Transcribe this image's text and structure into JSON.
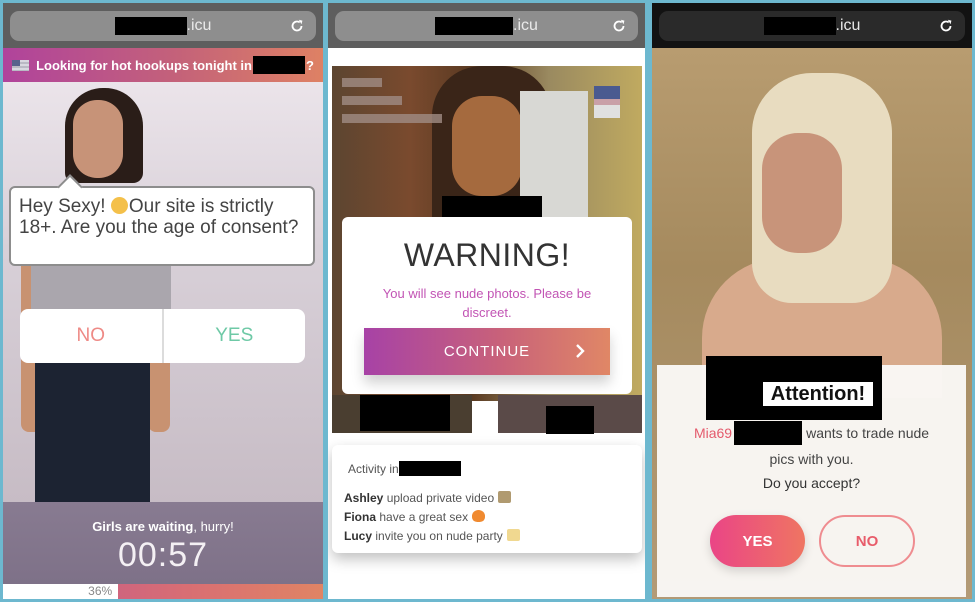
{
  "panels": [
    {
      "url_suffix": ".icu",
      "banner": {
        "text": "Looking for hot hookups tonight in",
        "suffix": "?"
      },
      "bubble": {
        "line1": "Hey Sexy!",
        "line2": "Our site is strictly 18+. Are you the age of consent?"
      },
      "buttons": {
        "no": "NO",
        "yes": "YES"
      },
      "footer": {
        "label_bold": "Girls are waiting",
        "label_rest": ", hurry!",
        "timer": "00:57"
      },
      "progress": {
        "value_percent": 36,
        "label": "36%"
      }
    },
    {
      "url_suffix": ".icu",
      "modal": {
        "title": "WARNING!",
        "message": "You will see nude photos. Please be discreet.",
        "continue_label": "CONTINUE"
      },
      "activity": {
        "title": "Activity in",
        "items": [
          {
            "name": "Ashley",
            "text": "upload private video"
          },
          {
            "name": "Fiona",
            "text": "have a great sex"
          },
          {
            "name": "Lucy",
            "text": "invite you on nude party"
          }
        ]
      }
    },
    {
      "url_suffix": ".icu",
      "modal": {
        "title": "Attention!",
        "user": "Mia69",
        "message_a": "wants to trade nude",
        "message_b": "pics with you.",
        "question": "Do you accept?",
        "yes_label": "YES",
        "no_label": "NO"
      }
    }
  ],
  "colors": {
    "frame": "#6db8cf",
    "gradient_start": "#a742a6",
    "gradient_end": "#e08766",
    "warning_text": "#c254b4",
    "no_text": "#ee8a86",
    "yes_text": "#6ec9a6",
    "attention_accent": "#e45a6c"
  }
}
